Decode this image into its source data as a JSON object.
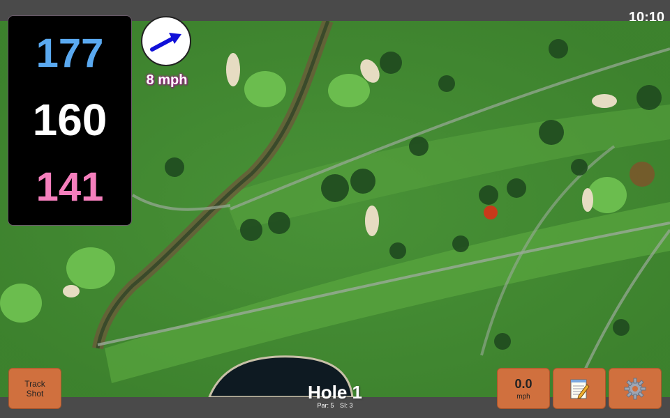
{
  "status": {
    "time": "10:10"
  },
  "distances": {
    "back": "177",
    "middle": "160",
    "front": "141"
  },
  "wind": {
    "speed_label": "8 mph",
    "icon": "wind-arrow-icon"
  },
  "hole": {
    "title": "Hole 1",
    "par": "Par: 5",
    "si": "SI: 3"
  },
  "buttons": {
    "track_shot_line1": "Track",
    "track_shot_line2": "Shot",
    "speed_value": "0.0",
    "speed_unit": "mph",
    "notes_icon": "notepad-icon",
    "settings_icon": "gear-icon"
  },
  "colors": {
    "back": "#5aa9f0",
    "middle": "#ffffff",
    "front": "#f57fbd",
    "button": "#d0703e"
  }
}
